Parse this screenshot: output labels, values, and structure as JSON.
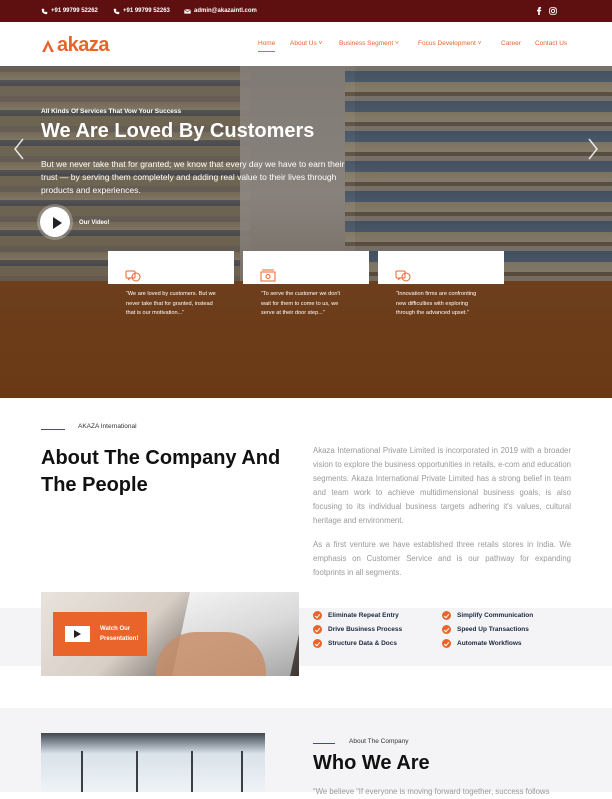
{
  "topbar": {
    "phone1": "+91 99799 52262",
    "phone2": "+91 99799 52263",
    "email": "admin@akazaintl.com",
    "social": [
      "facebook-icon",
      "instagram-icon"
    ]
  },
  "nav": {
    "logo": "akaza",
    "items": [
      {
        "label": "Home"
      },
      {
        "label": "About Us ˅"
      },
      {
        "label": "Business Segment ˅"
      },
      {
        "label": "Focus Development ˅"
      },
      {
        "label": "Career"
      },
      {
        "label": "Contact Us"
      }
    ]
  },
  "hero": {
    "kicker": "All Kinds Of Services That Vow Your Success",
    "title": "We Are Loved By Customers",
    "description": "But we never take that for granted; we know that every day we have to earn their trust — by serving them completely and adding real value to their lives through products and experiences.",
    "video_label": "Our Video!",
    "cards": [
      {
        "text": "“We are loved by customers. But we never take that for granted, instead that is our motivation...”",
        "icon": "chat-icon"
      },
      {
        "text": "“To serve the customer we don't wait for them to come to us, we serve at their door step...”",
        "icon": "cash-icon"
      },
      {
        "text": "“Innovation firms are confronting new difficulties with exploring through the advanced upset.”",
        "icon": "chat-icon"
      }
    ]
  },
  "about": {
    "kicker": "AKAZA International",
    "title": "About The Company And The People",
    "para1": "Akaza International Private Limited is incorporated in 2019 with a broader vision to explore the business opportunities in retails, e-com and education segments. Akaza International Private Limited has a strong belief in team and team work to achieve multidimensional business goals, is also focusing to its individual business targets adhering it's values, cultural heritage and environment.",
    "para2": "As a first venture we have established three retails stores in India. We emphasis on Customer Service and is our pathway for expanding footprints in all segments.",
    "watch_label": "Watch Our Presentation!",
    "features": [
      "Eliminate Repeat Entry",
      "Simplify Communication",
      "Drive Business Process",
      "Speed Up Transactions",
      "Structure Data & Docs",
      "Automate Workflows"
    ]
  },
  "who": {
    "kicker": "About The Company",
    "title": "Who We Are",
    "para": "“We believe “If everyone is moving forward together, success follows"
  },
  "colors": {
    "accent": "#e8642a",
    "topbar": "#5e0f0f",
    "hero_brown": "#6e3f1d",
    "navy": "#1a2740"
  }
}
